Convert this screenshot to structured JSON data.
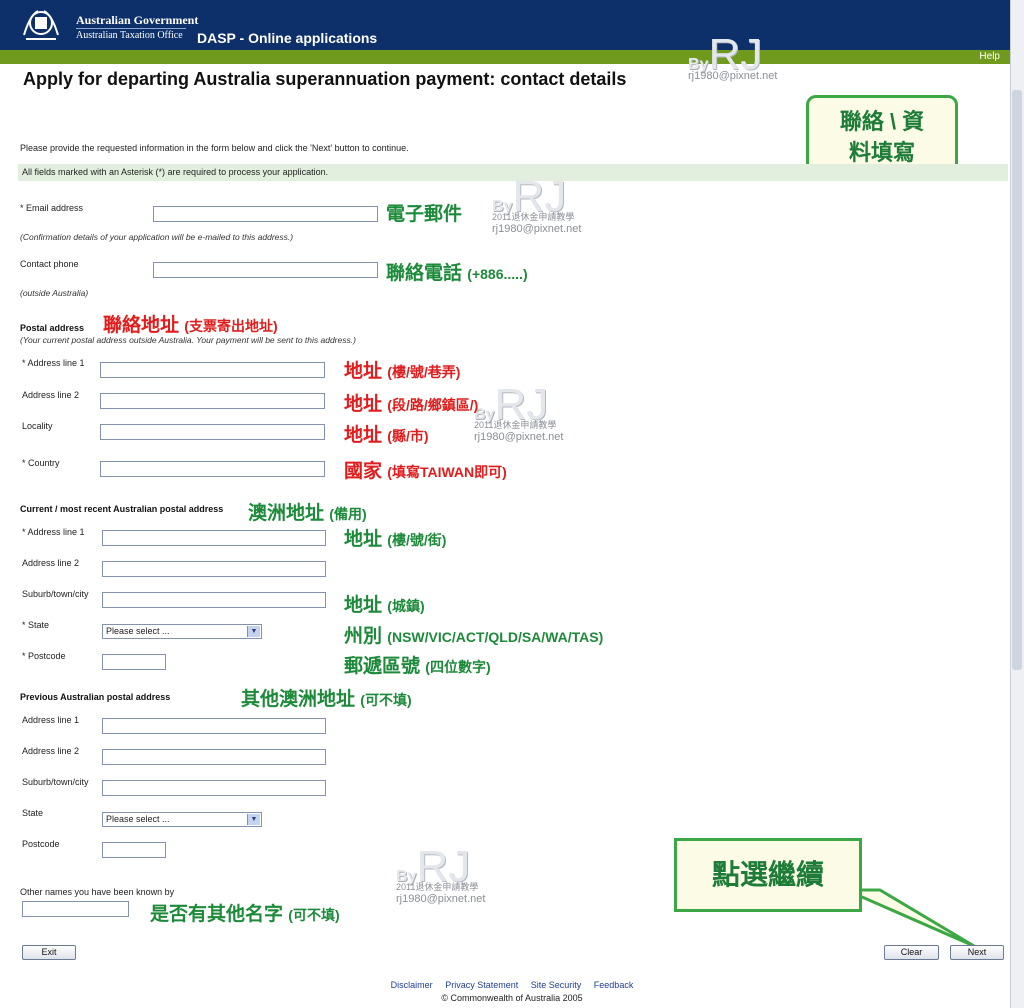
{
  "header": {
    "gov_line1": "Australian Government",
    "gov_line2": "Australian Taxation Office",
    "app_title": "DASP - Online applications",
    "help": "Help"
  },
  "page_title": "Apply for departing Australia superannuation payment: contact details",
  "intro": "Please provide the requested information in the form below and click the 'Next' button to continue.",
  "required_notice": "All fields marked with an Asterisk (*) are required to process your application.",
  "contact": {
    "email_label": "* Email address",
    "email_value": "",
    "email_note": "(Confirmation details of your application will be e-mailed to this address.)",
    "phone_label": "Contact phone",
    "phone_value": "",
    "phone_note": "(outside Australia)"
  },
  "postal": {
    "title": "Postal address",
    "note": "(Your current postal address outside Australia. Your payment will be sent to this address.)",
    "line1_label": "* Address line 1",
    "line2_label": "Address line 2",
    "locality_label": "Locality",
    "country_label": "* Country"
  },
  "current_au": {
    "title": "Current / most recent Australian postal address",
    "line1_label": "* Address line 1",
    "line2_label": "Address line 2",
    "suburb_label": "Suburb/town/city",
    "state_label": "* State",
    "state_value": "Please select ...",
    "postcode_label": "* Postcode"
  },
  "previous_au": {
    "title": "Previous Australian postal address",
    "line1_label": "Address line 1",
    "line2_label": "Address line 2",
    "suburb_label": "Suburb/town/city",
    "state_label": "State",
    "state_value": "Please select ...",
    "postcode_label": "Postcode"
  },
  "other_names_label": "Other names you have been known by",
  "buttons": {
    "exit": "Exit",
    "clear": "Clear",
    "next": "Next"
  },
  "footer": {
    "disclaimer": "Disclaimer",
    "privacy": "Privacy Statement",
    "security": "Site Security",
    "feedback": "Feedback",
    "copyright": "© Commonwealth of Australia 2005"
  },
  "annotations": {
    "callout_top_line1": "聯絡 \\ 資",
    "callout_top_line2": "料填寫",
    "email": "電子郵件",
    "phone_main": "聯絡電話",
    "phone_sub": "(+886.....)",
    "postal_main": "聯絡地址",
    "postal_sub": "(支票寄出地址)",
    "addr": "地址",
    "addr1_sub": "(樓/號/巷弄)",
    "addr2_sub": "(段/路/鄉鎮區/)",
    "locality_sub": "(縣/市)",
    "country_main": "國家",
    "country_sub": "(填寫TAIWAN即可)",
    "au_main": "澳洲地址",
    "au_sub": "(備用)",
    "au_addr1_sub": "(樓/號/街)",
    "suburb_sub": "(城鎮)",
    "state_main": "州別",
    "state_sub": "(NSW/VIC/ACT/QLD/SA/WA/TAS)",
    "postcode_main": "郵遞區號",
    "postcode_sub": "(四位數字)",
    "prev_main": "其他澳洲地址",
    "prev_sub": "(可不填)",
    "othernames_main": "是否有其他名字",
    "othernames_sub": "(可不填)",
    "next_callout": "點選繼續"
  },
  "watermark": {
    "by": "By",
    "rj": "RJ",
    "year_line": "2011退休金申請教學",
    "email": "rj1980@pixnet.net"
  },
  "colors": {
    "header_bg": "#0d2f6a",
    "green_bar": "#6f9a1e",
    "annotation_green": "#1d8a3a",
    "annotation_red": "#e01c1c"
  }
}
